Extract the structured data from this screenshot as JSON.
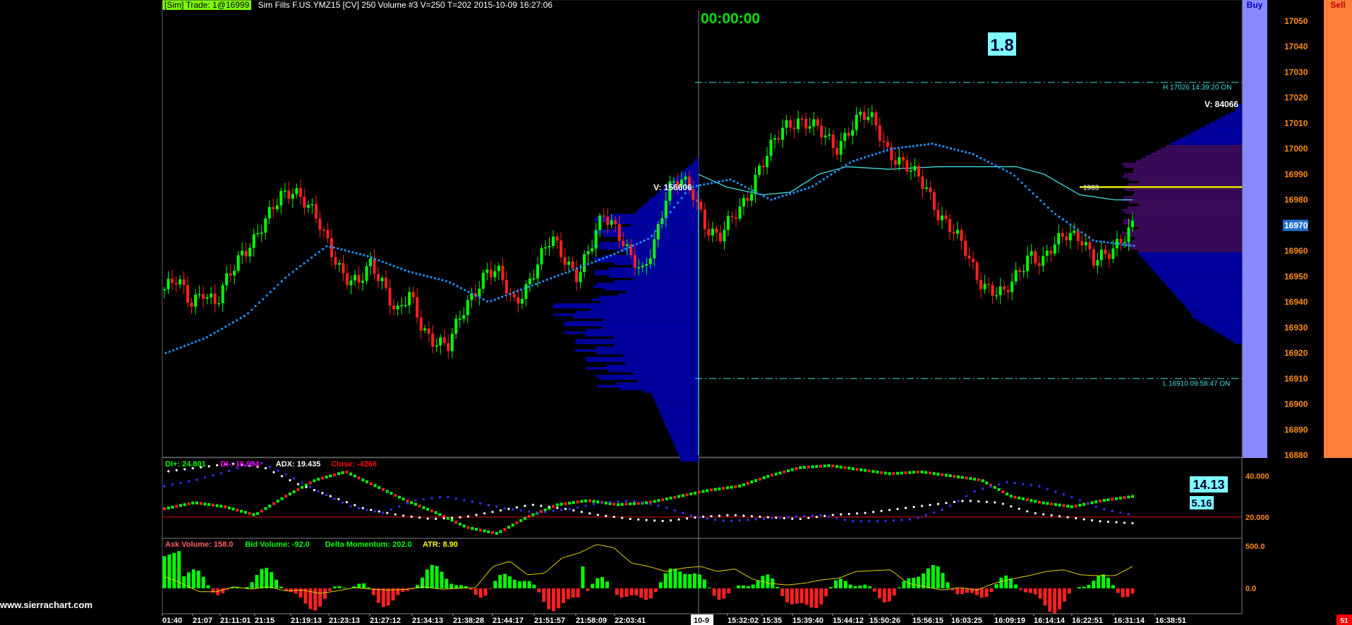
{
  "header": {
    "sim_badge": "[Sim]  Trade: 1@16999",
    "info": "Sim Fills  F.US.YMZ15 [CV]  250 Volume  #3 V=250 T=202 2015-10-09 16:27:06"
  },
  "countdown": "00:00:00",
  "spread_badge": "1.8",
  "side_buttons": {
    "buy": "Buy",
    "sell": "Sell"
  },
  "price_axis": {
    "ticks": [
      "17050",
      "17040",
      "17030",
      "17020",
      "17010",
      "17000",
      "16990",
      "16980",
      "16970",
      "16960",
      "16950",
      "16940",
      "16930",
      "16920",
      "16910",
      "16900",
      "16890",
      "16880"
    ],
    "current_price": "16970"
  },
  "annotations": {
    "high_line": "H 17026  14:39:20  ON",
    "low_line": "L 16910  09:58:47  ON",
    "volume_right": "V: 84066",
    "volume_left": "V: 156606",
    "poc_label": "1983"
  },
  "panel2": {
    "legend": [
      {
        "text": "DI+: 24.801",
        "color": "#00ff00"
      },
      {
        "text": "DI-: 16.904",
        "color": "#ff00ff"
      },
      {
        "text": "ADX: 19.435",
        "color": "#ffffff"
      },
      {
        "text": "Close: -4266",
        "color": "#ff0000"
      }
    ],
    "ticks": [
      "40.000",
      "20.000"
    ],
    "badge_top": "14.13",
    "badge_bottom": "5.16"
  },
  "panel3": {
    "legend": [
      {
        "text": "Ask Volume: 158.0",
        "color": "#ff6060"
      },
      {
        "text": "Bid Volume: -92.0",
        "color": "#00ff00"
      },
      {
        "text": "Delta Momentum: 202.0",
        "color": "#00ff00"
      },
      {
        "text": "ATR: 8.90",
        "color": "#ffff00"
      }
    ],
    "ticks": [
      "500.0",
      "0.0"
    ]
  },
  "time_axis": [
    "01:40",
    "21:07",
    "21:11:01",
    "21:15",
    "21:19:13",
    "21:23:13",
    "21:27:12",
    "21:34:13",
    "21:38:28",
    "21:44:17",
    "21:51:57",
    "21:58:09",
    "22:03:41",
    "10-9",
    "15:32:02",
    "15:35",
    "15:39:40",
    "15:44:12",
    "15:50:26",
    "15:56:15",
    "16:03:25",
    "16:09:19",
    "16:14:14",
    "16:22:51",
    "16:31:14",
    "16:38:51"
  ],
  "corner_label": "51",
  "watermark": "www.sierrachart.com",
  "colors": {
    "up": "#00ff00",
    "down": "#ff2020",
    "vwap": "#1e90ff",
    "profile": "#0000a0",
    "profile_current": "#3a0a5a",
    "session_line": "#40e0e0",
    "poc": "#c8c800"
  },
  "chart_data": {
    "type": "candlestick",
    "title": "F.US.YMZ15 [CV] 250 Volume",
    "ylim": [
      16878,
      17056
    ],
    "price_anchors": [
      16945,
      16948,
      16940,
      16945,
      16938,
      16950,
      16960,
      16965,
      16972,
      16982,
      16985,
      16978,
      16970,
      16960,
      16950,
      16946,
      16955,
      16948,
      16935,
      16942,
      16930,
      16925,
      16922,
      16935,
      16945,
      16952,
      16950,
      16940,
      16946,
      16955,
      16965,
      16958,
      16950,
      16960,
      16975,
      16970,
      16958,
      16950,
      16965,
      16985,
      16987,
      16982,
      16970,
      16965,
      16972,
      16980,
      16992,
      17000,
      17008,
      17012,
      17010,
      17005,
      17000,
      17008,
      17013,
      17010,
      17000,
      16995,
      16990,
      16985,
      16975,
      16968,
      16960,
      16950,
      16945,
      16942,
      16950,
      16960,
      16955,
      16962,
      16968,
      16966,
      16955,
      16958,
      16965,
      16970
    ],
    "vwap_anchors": [
      16920,
      16926,
      16935,
      16950,
      16962,
      16958,
      16952,
      16948,
      16940,
      16946,
      16952,
      16958,
      16965,
      16985,
      16988,
      16980,
      16985,
      16995,
      17000,
      17002,
      16998,
      16990,
      16975,
      16964,
      16962
    ],
    "dmi": {
      "di_plus": 24.801,
      "di_minus": 16.904,
      "adx": 19.435,
      "close": -4266,
      "ylim": [
        10,
        48
      ]
    },
    "volume": {
      "ask_volume": 158.0,
      "bid_volume": -92.0,
      "delta_momentum": 202.0,
      "atr": 8.9,
      "ylim": [
        -280,
        760
      ]
    }
  }
}
